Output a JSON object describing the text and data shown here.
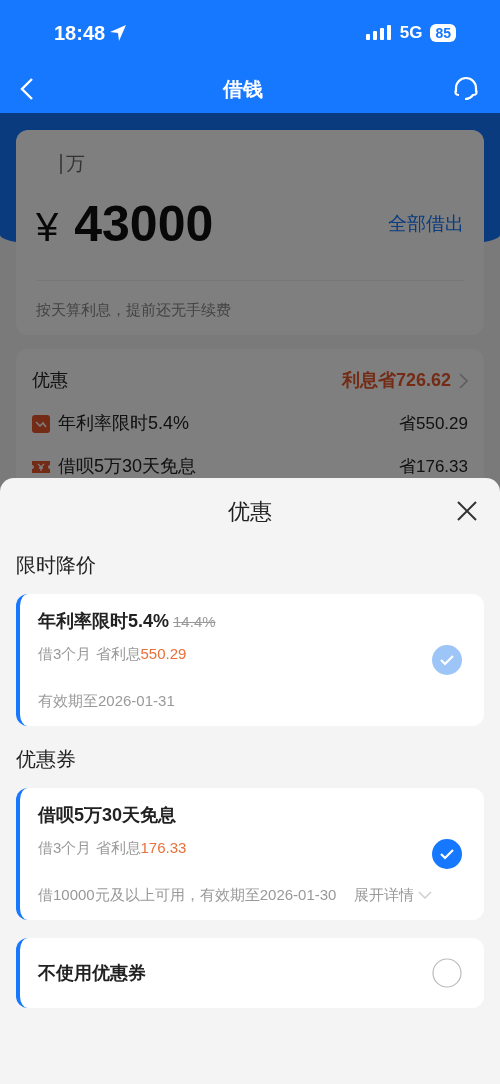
{
  "status_bar": {
    "time": "18:48",
    "network": "5G",
    "battery": "85"
  },
  "nav": {
    "title": "借钱"
  },
  "amount_card": {
    "unit_hint": "万",
    "currency": "¥",
    "amount": "43000",
    "all_button": "全部借出",
    "note": "按天算利息，提前还无手续费"
  },
  "discount_summary": {
    "title": "优惠",
    "total": "利息省726.62",
    "items": [
      {
        "kind": "rate",
        "label": "年利率限时5.4%",
        "saving": "省550.29"
      },
      {
        "kind": "coupon",
        "label": "借呗5万30天免息",
        "saving": "省176.33"
      }
    ]
  },
  "sheet": {
    "title": "优惠",
    "sections": [
      {
        "heading": "限时降价",
        "options": [
          {
            "title": "年利率限时5.4%",
            "original": "14.4%",
            "term": "借3个月 省利息",
            "saving": "550.29",
            "validity": "有效期至2026-01-31",
            "selected": true,
            "disabled": true
          }
        ]
      },
      {
        "heading": "优惠券",
        "options": [
          {
            "title": "借呗5万30天免息",
            "term": "借3个月 省利息",
            "saving": "176.33",
            "validity": "借10000元及以上可用，有效期至2026-01-30",
            "details_link": "展开详情",
            "selected": true,
            "disabled": false
          },
          {
            "title": "不使用优惠券",
            "selected": false,
            "disabled": false
          }
        ]
      }
    ]
  }
}
